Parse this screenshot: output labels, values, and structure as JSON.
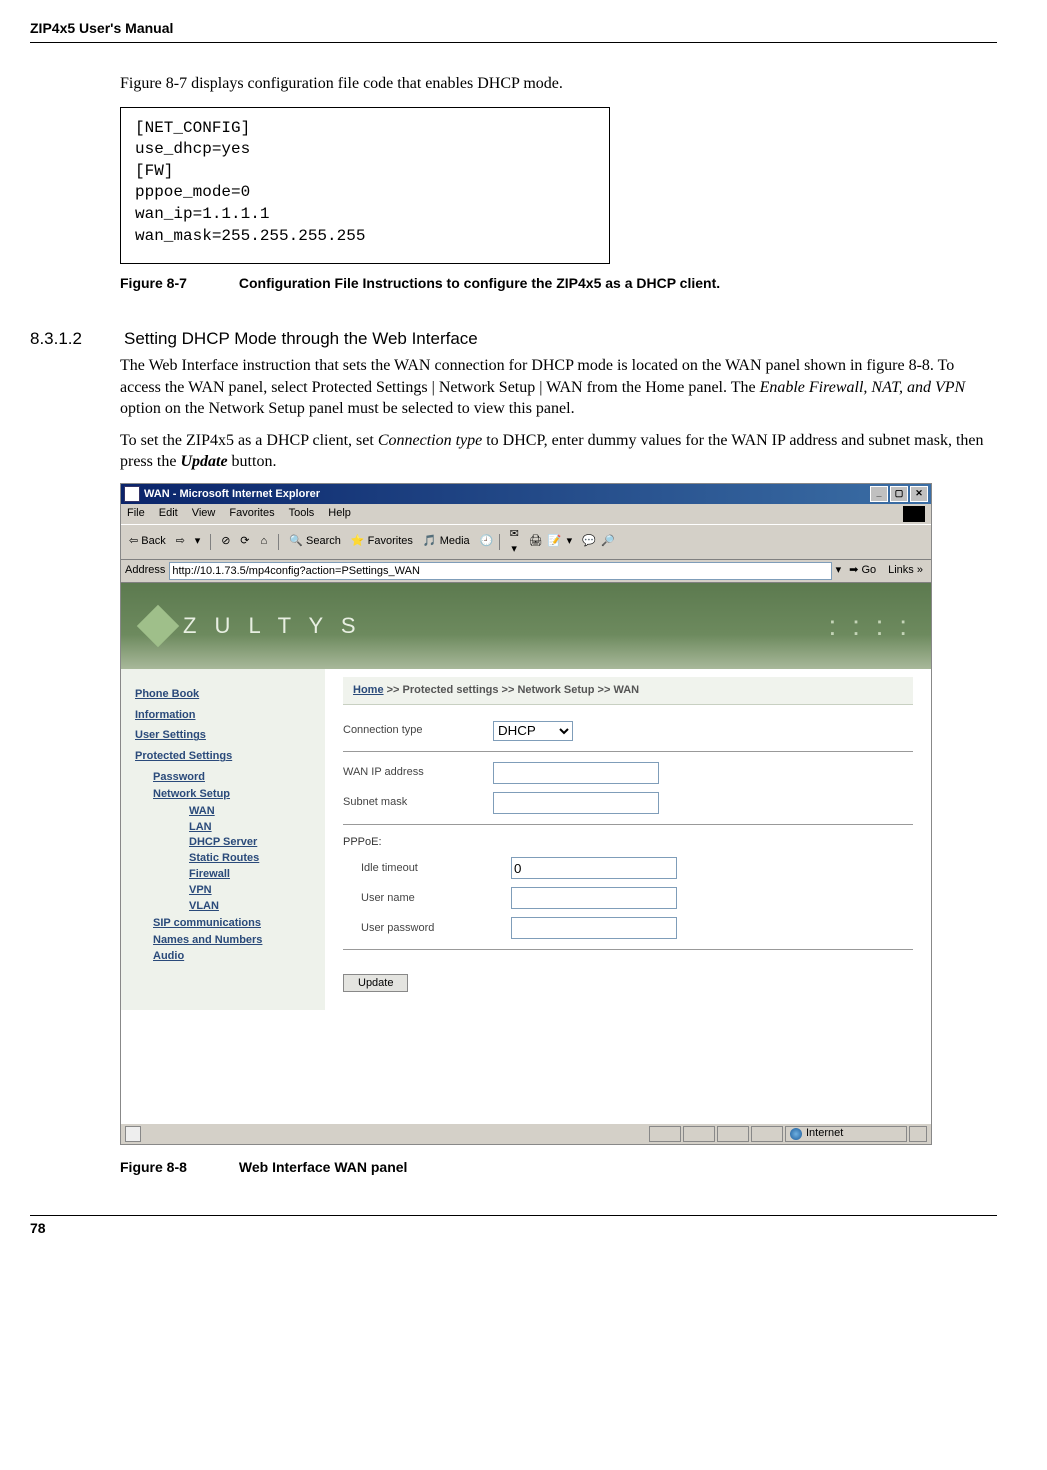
{
  "header": "ZIP4x5 User's Manual",
  "intro": "Figure 8-7 displays configuration file code that enables DHCP mode.",
  "config_code": "[NET_CONFIG]\nuse_dhcp=yes\n[FW]\npppoe_mode=0\nwan_ip=1.1.1.1\nwan_mask=255.255.255.255",
  "fig87": {
    "num": "Figure 8-7",
    "caption": "Configuration File Instructions to configure the ZIP4x5 as a DHCP client."
  },
  "section": {
    "num": "8.3.1.2",
    "title": "Setting DHCP Mode through the Web Interface"
  },
  "para1a": "The Web Interface instruction that sets the WAN connection for DHCP mode is located on the WAN panel shown in figure 8-8. To access the WAN panel, select Protected Settings | Network Setup | WAN from the Home panel. The ",
  "para1b": "Enable Firewall, NAT, and VPN",
  "para1c": " option on the Network Setup panel must be selected to view this panel.",
  "para2a": "To set the ZIP4x5 as a DHCP client, set ",
  "para2b": "Connection type",
  "para2c": " to DHCP, enter dummy values for the WAN IP address and subnet mask, then press the ",
  "para2d": "Update",
  "para2e": " button.",
  "ie": {
    "title": "WAN - Microsoft Internet Explorer",
    "menu": [
      "File",
      "Edit",
      "View",
      "Favorites",
      "Tools",
      "Help"
    ],
    "tb": {
      "back": "Back",
      "search": "Search",
      "favorites": "Favorites",
      "media": "Media"
    },
    "address_label": "Address",
    "url": "http://10.1.73.5/mp4config?action=PSettings_WAN",
    "go": "Go",
    "links": "Links",
    "brand": "Z U L T Y S",
    "sidebar": {
      "phonebook": "Phone Book",
      "information": "Information",
      "usersettings": "User Settings",
      "protected": "Protected Settings",
      "password": "Password",
      "network": "Network Setup",
      "wan": "WAN",
      "lan": "LAN",
      "dhcp": "DHCP Server",
      "static": "Static Routes",
      "firewall": "Firewall",
      "vpn": "VPN",
      "vlan": "VLAN",
      "sip": "SIP communications",
      "names": "Names and Numbers",
      "audio": "Audio"
    },
    "bc": {
      "home": "Home",
      "sep": " >> ",
      "ps": "Protected settings",
      "ns": "Network Setup",
      "wan": "WAN"
    },
    "labels": {
      "conntype": "Connection type",
      "wanip": "WAN IP address",
      "subnet": "Subnet mask",
      "pppoe": "PPPoE:",
      "idle": "Idle timeout",
      "user": "User name",
      "pass": "User password",
      "update": "Update"
    },
    "values": {
      "conntype": "DHCP",
      "idle": "0"
    },
    "status": "Internet"
  },
  "fig88": {
    "num": "Figure 8-8",
    "caption": "Web Interface WAN panel"
  },
  "pagenum": "78"
}
